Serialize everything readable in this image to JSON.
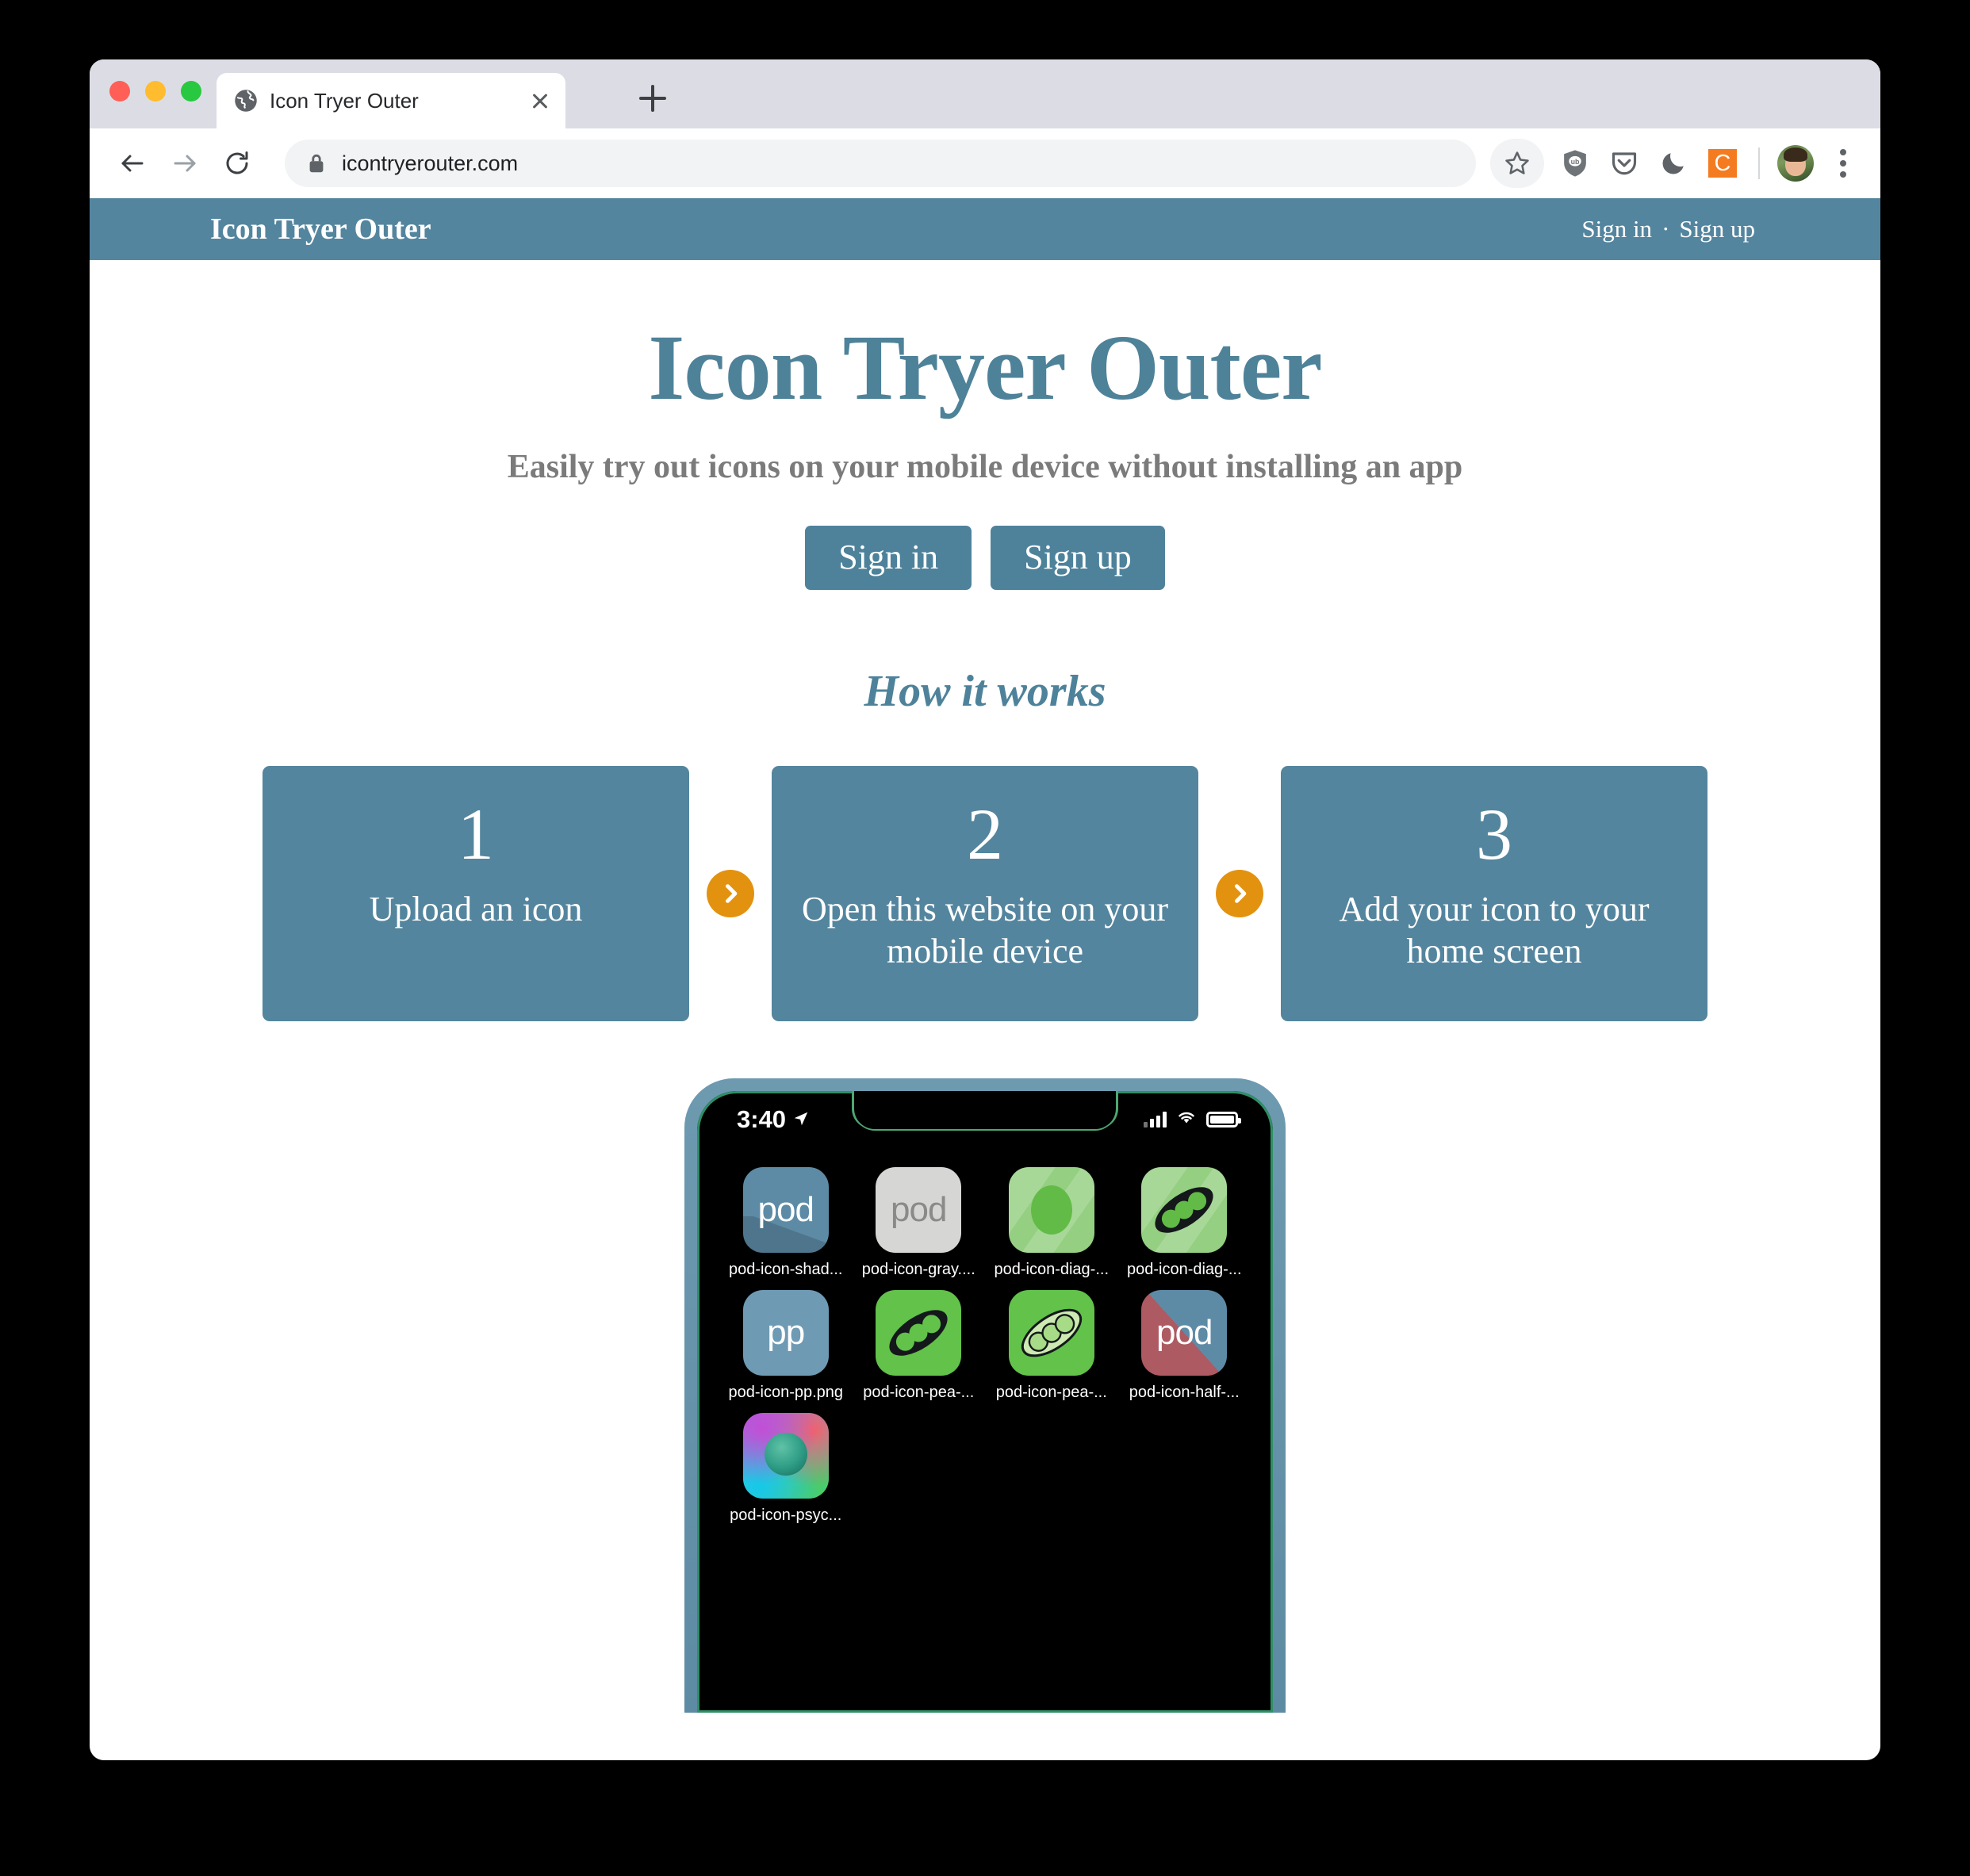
{
  "browser": {
    "tab": {
      "title": "Icon Tryer Outer",
      "favicon": "globe-icon",
      "close": "close-icon"
    },
    "new_tab": "+",
    "omnibox": {
      "url": "icontryerouter.com",
      "lock": "lock-icon"
    },
    "toolbar_icons": [
      "back-icon",
      "forward-icon",
      "reload-icon",
      "bookmark-star-icon",
      "ublock-origin-icon",
      "pocket-icon",
      "dark-mode-moon-icon",
      "extension-c-icon",
      "profile-avatar",
      "chrome-menu-kebab-icon"
    ],
    "extension_c_label": "C"
  },
  "site": {
    "nav": {
      "brand": "Icon Tryer Outer",
      "sign_in": "Sign in",
      "separator": "·",
      "sign_up": "Sign up"
    },
    "hero": {
      "title": "Icon Tryer Outer",
      "subtitle": "Easily try out icons on your mobile device without installing an app",
      "sign_in_button": "Sign in",
      "sign_up_button": "Sign up"
    },
    "how_it_works": {
      "heading": "How it works",
      "arrow": "chevron-right-icon",
      "steps": [
        {
          "number": "1",
          "text": "Upload an icon"
        },
        {
          "number": "2",
          "text": "Open this website on your mobile device"
        },
        {
          "number": "3",
          "text": "Add your icon to your home screen"
        }
      ]
    },
    "phone": {
      "status": {
        "time": "3:40",
        "location_arrow": "location-arrow-icon",
        "signal": "signal-bars-icon",
        "wifi": "wifi-icon",
        "battery": "battery-icon"
      },
      "apps": [
        [
          {
            "label": "pod-icon-shad...",
            "style": "pod-blue-shadow",
            "glyph": "pod"
          },
          {
            "label": "pod-icon-gray....",
            "style": "pod-gray",
            "glyph": "pod"
          },
          {
            "label": "pod-icon-diag-...",
            "style": "green-circle-diag",
            "glyph": ""
          },
          {
            "label": "pod-icon-diag-...",
            "style": "green-peapod-diag",
            "glyph": ""
          }
        ],
        [
          {
            "label": "pod-icon-pp.png",
            "style": "blue-pp",
            "glyph": "pp"
          },
          {
            "label": "pod-icon-pea-...",
            "style": "green-peapod-dark",
            "glyph": ""
          },
          {
            "label": "pod-icon-pea-...",
            "style": "green-peapod-light",
            "glyph": ""
          },
          {
            "label": "pod-icon-half-...",
            "style": "half-red-blue",
            "glyph": "pod"
          }
        ],
        [
          {
            "label": "pod-icon-psyc...",
            "style": "psychedelic",
            "glyph": ""
          }
        ]
      ]
    }
  },
  "colors": {
    "accent_blue": "#54859e",
    "title_blue": "#4e8299",
    "orange": "#e3920f",
    "subtitle_gray": "#7b7b7b",
    "page_black": "#000000"
  }
}
